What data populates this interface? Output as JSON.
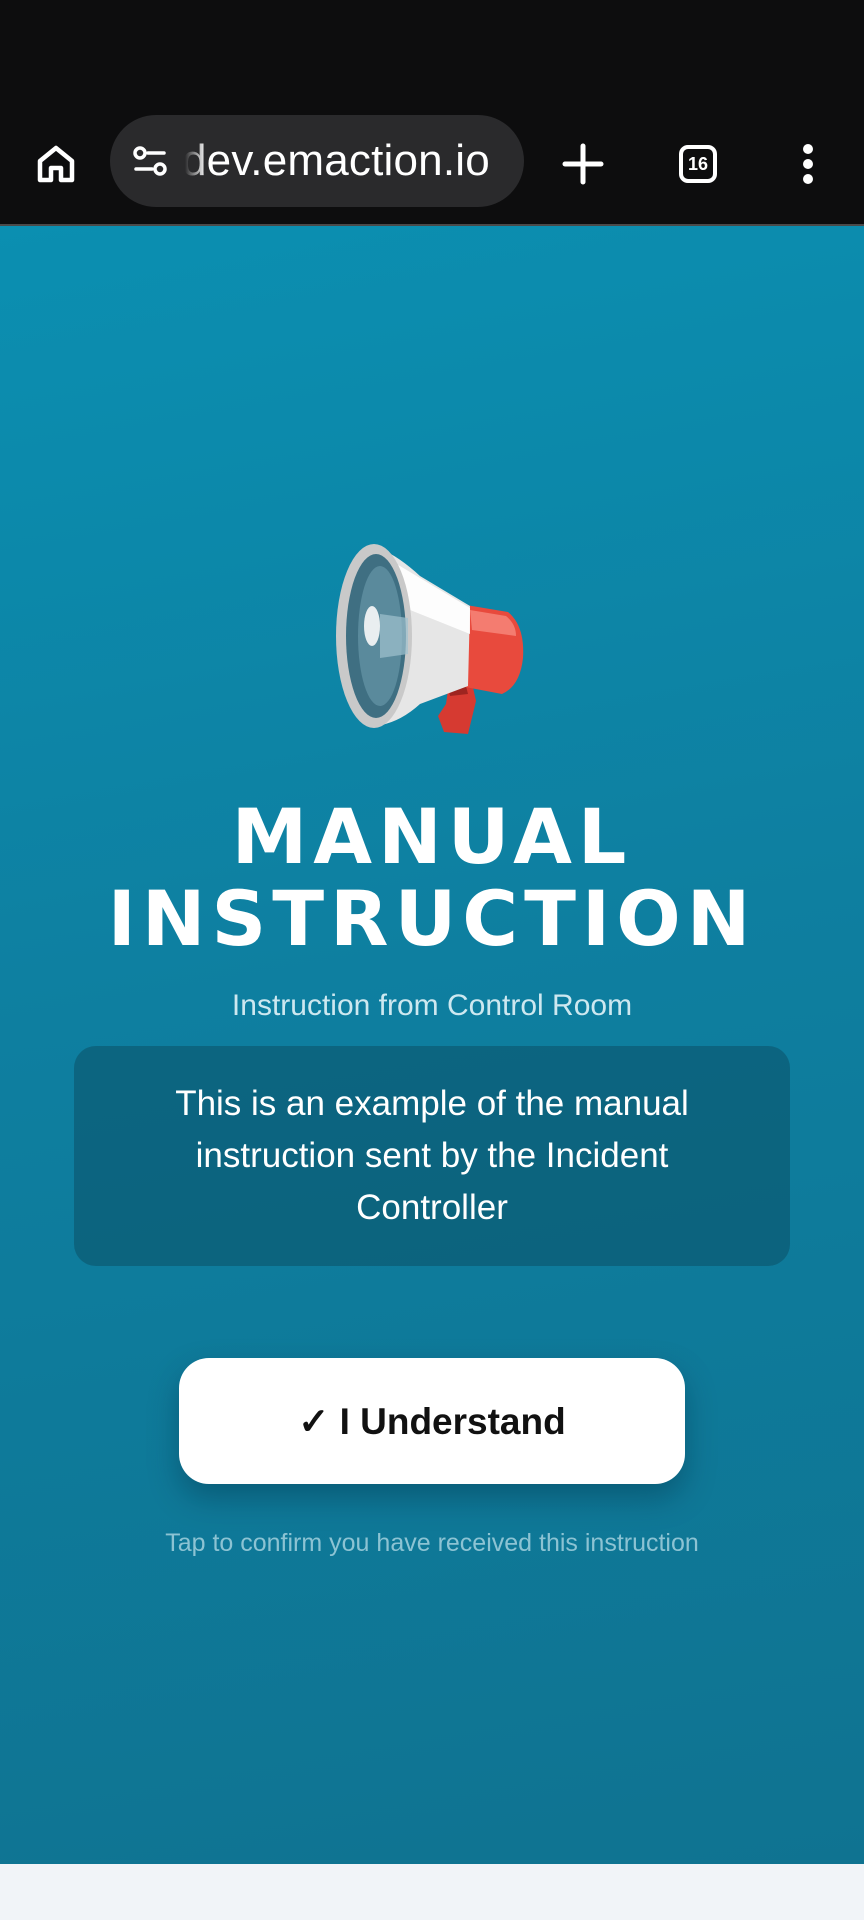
{
  "browser": {
    "url": "dev.emaction.io",
    "tab_count": "16"
  },
  "notice": {
    "icon": "megaphone-icon",
    "title_line1": "MANUAL",
    "title_line2": "INSTRUCTION",
    "subtitle": "Instruction from Control Room",
    "message": "This is an example of the manual instruction sent by the Incident Controller",
    "confirm_button": "✓ I Understand",
    "hint": "Tap to confirm you have received this instruction"
  },
  "colors": {
    "browser_bg": "#0d0d0e",
    "url_pill": "#2a2a2c",
    "page_bg_top": "#0b8fb1",
    "page_bg_bottom": "#0f7391",
    "button_bg": "#ffffff",
    "megaphone_red": "#e53b32"
  }
}
